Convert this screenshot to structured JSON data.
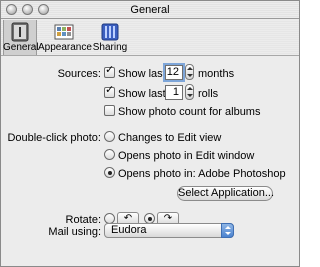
{
  "window": {
    "title": "General"
  },
  "toolbar": {
    "items": [
      {
        "label": "General",
        "icon": "general-prefs-icon",
        "selected": true
      },
      {
        "label": "Appearance",
        "icon": "appearance-icon",
        "selected": false
      },
      {
        "label": "Sharing",
        "icon": "sharing-icon",
        "selected": false
      }
    ]
  },
  "sources": {
    "label": "Sources:",
    "show_last_months": {
      "checked": true,
      "prefix": "Show last",
      "value": "12",
      "unit": "months"
    },
    "show_last_rolls": {
      "checked": true,
      "prefix": "Show last",
      "value": "1",
      "unit": "rolls"
    },
    "show_photo_count": {
      "checked": false,
      "label": "Show photo count for albums"
    }
  },
  "double_click": {
    "label": "Double-click photo:",
    "options": [
      {
        "label": "Changes to Edit view",
        "selected": false
      },
      {
        "label": "Opens photo in Edit window",
        "selected": false
      },
      {
        "label": "Opens photo in: Adobe Photoshop",
        "selected": true
      }
    ],
    "select_app_label": "Select Application..."
  },
  "rotate": {
    "label": "Rotate:",
    "options": [
      {
        "icon": "rotate-counterclockwise-icon",
        "glyph": "↶",
        "selected": false
      },
      {
        "icon": "rotate-clockwise-icon",
        "glyph": "↷",
        "selected": true
      }
    ]
  },
  "mail": {
    "label": "Mail using:",
    "value": "Eudora"
  }
}
